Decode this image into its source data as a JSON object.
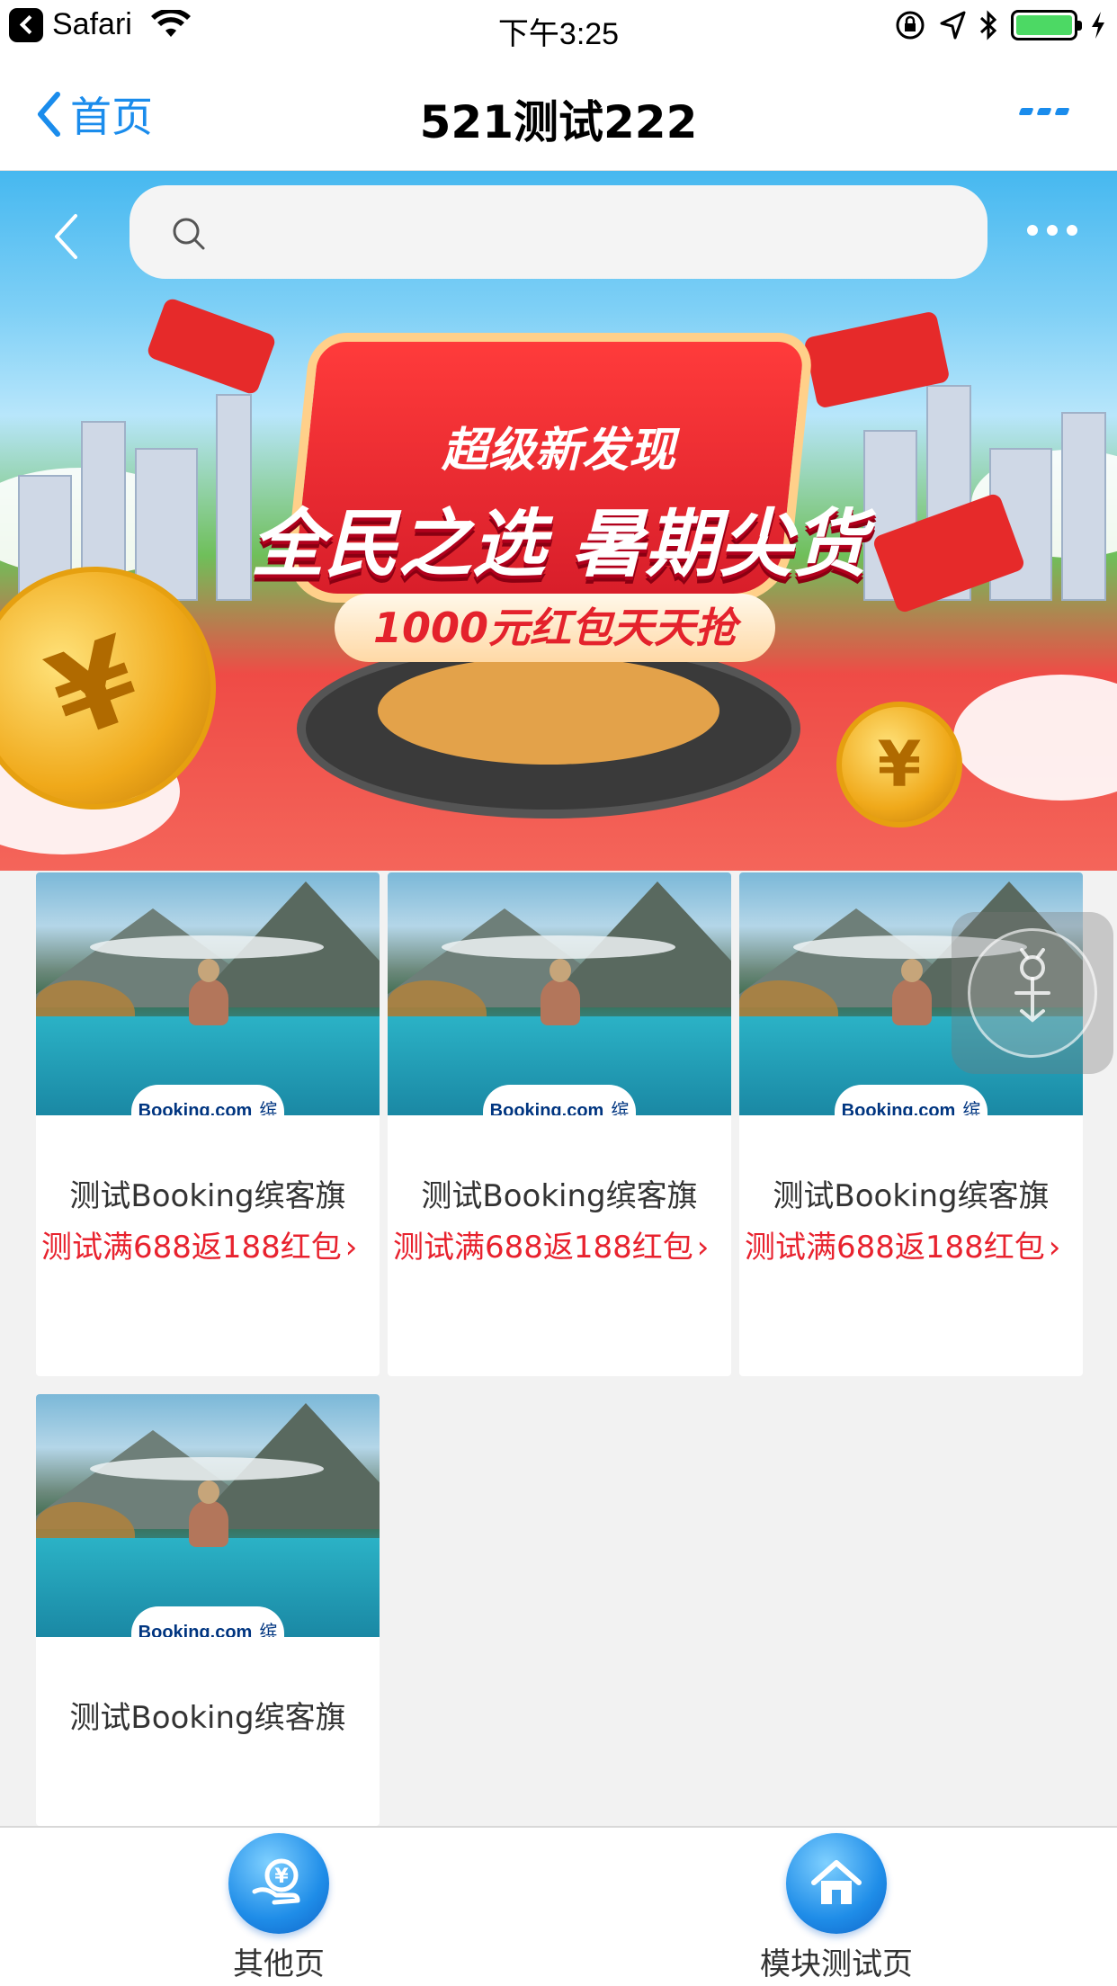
{
  "status_bar": {
    "app": "Safari",
    "time": "下午3:25"
  },
  "nav": {
    "back_label": "首页",
    "title": "521测试222"
  },
  "banner": {
    "headline_top": "超级新发现",
    "headline_main": "全民之选 暑期尖货",
    "headline_sub": "1000元红包天天抢"
  },
  "products": [
    {
      "brand": "Booking.com",
      "brand_cn": "缤客",
      "title": "测试Booking缤客旗",
      "promo": "测试满688返188红包"
    },
    {
      "brand": "Booking.com",
      "brand_cn": "缤客",
      "title": "测试Booking缤客旗",
      "promo": "测试满688返188红包"
    },
    {
      "brand": "Booking.com",
      "brand_cn": "缤客",
      "title": "测试Booking缤客旗",
      "promo": "测试满688返188红包"
    },
    {
      "brand": "Booking.com",
      "brand_cn": "缤客",
      "title": "测试Booking缤客旗",
      "promo": ""
    }
  ],
  "tabs": [
    {
      "label": "其他页",
      "icon": "yen-hand-icon"
    },
    {
      "label": "模块测试页",
      "icon": "home-icon"
    }
  ],
  "colors": {
    "accent": "#1a8cec",
    "promo_red": "#e8222e"
  }
}
